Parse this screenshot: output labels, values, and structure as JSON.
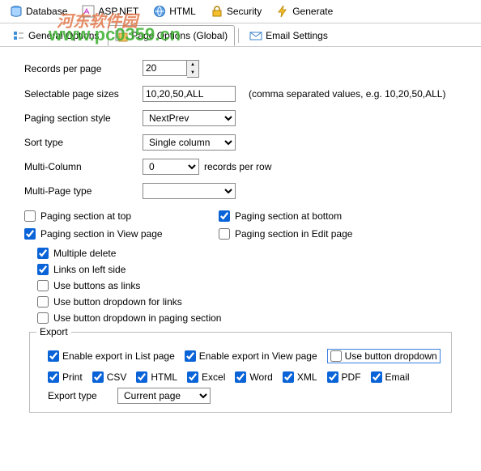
{
  "toolbar": {
    "database": "Database",
    "aspnet": "ASP.NET",
    "html": "HTML",
    "security": "Security",
    "generate": "Generate"
  },
  "tabs": {
    "general": "General Options",
    "page": "Page Options (Global)",
    "email": "Email Settings"
  },
  "watermark_cn": "河东软件园",
  "watermark": "www.pc0359.cn",
  "form": {
    "records_per_page_label": "Records per page",
    "records_per_page_value": "20",
    "selectable_sizes_label": "Selectable page sizes",
    "selectable_sizes_value": "10,20,50,ALL",
    "selectable_sizes_hint": "(comma separated values, e.g. 10,20,50,ALL)",
    "paging_style_label": "Paging section style",
    "paging_style_value": "NextPrev",
    "sort_type_label": "Sort type",
    "sort_type_value": "Single column",
    "multi_column_label": "Multi-Column",
    "multi_column_value": "0",
    "multi_column_suffix": "records per row",
    "multi_page_type_label": "Multi-Page type",
    "multi_page_type_value": ""
  },
  "checks": {
    "paging_top": "Paging section at top",
    "paging_bottom": "Paging section at bottom",
    "paging_view": "Paging section in View page",
    "paging_edit": "Paging section in Edit page",
    "multiple_delete": "Multiple delete",
    "links_left": "Links on left side",
    "buttons_as_links": "Use buttons as links",
    "button_dropdown_links": "Use button dropdown for links",
    "button_dropdown_paging": "Use button dropdown in paging section"
  },
  "export": {
    "legend": "Export",
    "enable_list": "Enable export in List page",
    "enable_view": "Enable export in View page",
    "use_button_dropdown": "Use button dropdown",
    "print": "Print",
    "csv": "CSV",
    "html": "HTML",
    "excel": "Excel",
    "word": "Word",
    "xml": "XML",
    "pdf": "PDF",
    "email": "Email",
    "type_label": "Export type",
    "type_value": "Current page"
  }
}
